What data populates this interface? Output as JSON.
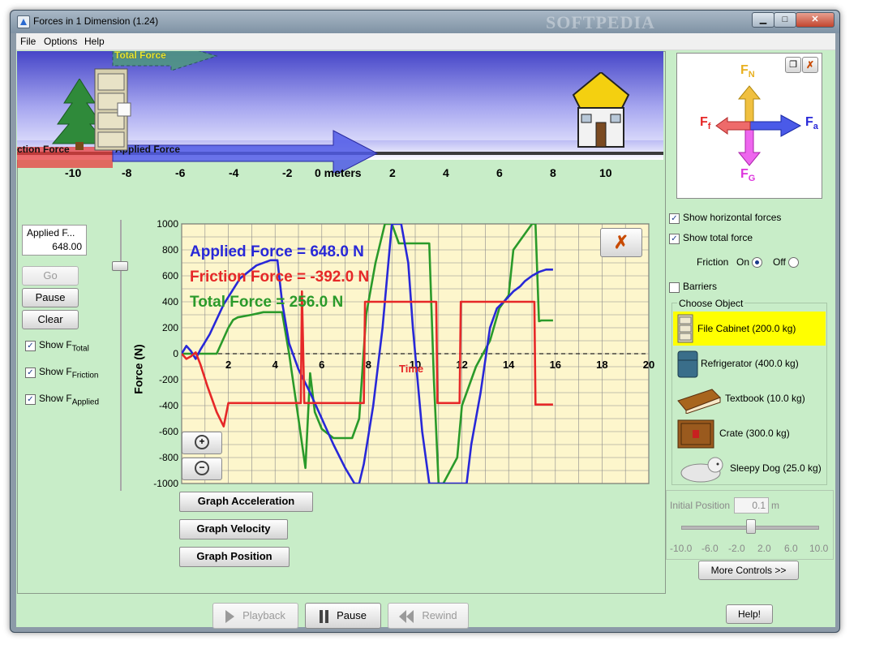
{
  "window": {
    "title": "Forces in 1 Dimension (1.24)",
    "watermark": "SOFTPEDIA",
    "controls": {
      "minimize": "▁",
      "maximize": "□",
      "close": "✕"
    }
  },
  "menu": [
    "File",
    "Options",
    "Help"
  ],
  "scene": {
    "total_force_label": "Total Force",
    "friction_force_label": "ction Force",
    "applied_force_label": "Applied Force",
    "axis_ticks": [
      "-10",
      "-8",
      "-6",
      "-4",
      "-2",
      "0 meters",
      "2",
      "4",
      "6",
      "8",
      "10"
    ]
  },
  "fbd": {
    "fn": "F",
    "fn_sub": "N",
    "ff": "F",
    "ff_sub": "f",
    "fa": "F",
    "fa_sub": "a",
    "fg": "F",
    "fg_sub": "G"
  },
  "left_panel": {
    "applied_field_title": "Applied F...",
    "applied_field_value": "648.00",
    "go": "Go",
    "pause": "Pause",
    "clear": "Clear",
    "show_total": "Show F",
    "show_total_sub": "Total",
    "show_friction": "Show F",
    "show_friction_sub": "Friction",
    "show_applied": "Show F",
    "show_applied_sub": "Applied"
  },
  "graph": {
    "ylabel": "Force (N)",
    "xlabel": "Time",
    "applied_readout": "Applied Force =  648.0 N",
    "friction_readout": "Friction Force =  -392.0 N",
    "total_readout": "Total Force =  256.0 N",
    "close_glyph": "✗",
    "zoom_in": "+",
    "zoom_out": "−"
  },
  "chart_data": {
    "type": "line",
    "xlabel": "Time",
    "ylabel": "Force (N)",
    "xlim": [
      0,
      20
    ],
    "ylim": [
      -1000,
      1000
    ],
    "x_ticks": [
      "2",
      "4",
      "6",
      "8",
      "10",
      "12",
      "14",
      "16",
      "18",
      "20"
    ],
    "y_ticks": [
      "1000",
      "800",
      "600",
      "400",
      "200",
      "0",
      "-200",
      "-400",
      "-600",
      "-800",
      "-1000"
    ],
    "grid": true,
    "series": [
      {
        "name": "Applied Force",
        "color": "#2828d8",
        "x": [
          0,
          0.2,
          0.4,
          0.6,
          0.8,
          1.2,
          1.8,
          2.5,
          3.2,
          3.8,
          4.1,
          4.3,
          4.6,
          5.0,
          5.5,
          6.0,
          6.5,
          7.0,
          7.4,
          7.6,
          7.8,
          8.2,
          8.6,
          9.0,
          9.4,
          9.7,
          9.9,
          10.3,
          10.6,
          10.9,
          11.05,
          11.1,
          12.2,
          12.4,
          12.8,
          13.2,
          13.5,
          13.9,
          14.2,
          14.5,
          14.7,
          15.0,
          15.3,
          15.6,
          15.9
        ],
        "y": [
          0,
          60,
          20,
          -40,
          30,
          150,
          380,
          580,
          680,
          720,
          720,
          400,
          80,
          -120,
          -300,
          -500,
          -700,
          -880,
          -1000,
          -1000,
          -850,
          -400,
          200,
          1000,
          1000,
          700,
          200,
          -600,
          -1000,
          -1000,
          -1000,
          -1000,
          -1000,
          -700,
          -300,
          200,
          350,
          420,
          480,
          520,
          560,
          600,
          630,
          648,
          648
        ]
      },
      {
        "name": "Friction Force",
        "color": "#e62828",
        "x": [
          0,
          0.2,
          0.4,
          0.6,
          0.8,
          1.1,
          1.5,
          1.8,
          2.0,
          2.2,
          5.1,
          5.15,
          5.25,
          7.8,
          7.85,
          10.9,
          10.95,
          11.0,
          11.1,
          11.9,
          11.95,
          15.1,
          15.15,
          15.9
        ],
        "y": [
          0,
          -40,
          -20,
          10,
          -80,
          -250,
          -450,
          -560,
          -380,
          -380,
          -380,
          480,
          -380,
          -380,
          400,
          400,
          -380,
          -380,
          -380,
          -380,
          400,
          400,
          -392,
          -392
        ]
      },
      {
        "name": "Total Force",
        "color": "#2a9a2a",
        "x": [
          0,
          1.0,
          1.5,
          2.0,
          2.2,
          2.4,
          3.0,
          3.5,
          4.3,
          4.6,
          5.0,
          5.3,
          5.5,
          5.7,
          6.0,
          6.5,
          7.3,
          7.6,
          7.9,
          8.3,
          8.7,
          9.0,
          9.3,
          10.6,
          10.8,
          11.0,
          11.2,
          11.8,
          12.0,
          12.6,
          13.2,
          13.6,
          14.0,
          14.2,
          14.6,
          15.0,
          15.15,
          15.3,
          15.4,
          15.9
        ],
        "y": [
          0,
          0,
          0,
          200,
          260,
          280,
          300,
          320,
          320,
          0,
          -500,
          -880,
          -150,
          -450,
          -580,
          -650,
          -650,
          -500,
          300,
          700,
          1000,
          1000,
          850,
          850,
          -200,
          -1000,
          -1000,
          -800,
          -400,
          -100,
          100,
          350,
          450,
          800,
          900,
          1000,
          1000,
          250,
          256,
          256
        ]
      }
    ]
  },
  "graph_buttons": [
    "Graph Acceleration",
    "Graph Velocity",
    "Graph Position"
  ],
  "right_panel": {
    "show_horizontal": "Show horizontal forces",
    "show_total_force": "Show total force",
    "friction_label": "Friction",
    "friction_on": "On",
    "friction_off": "Off",
    "barriers": "Barriers",
    "choose_object": "Choose Object",
    "objects": [
      "File Cabinet (200.0 kg)",
      "Refrigerator (400.0 kg)",
      "Textbook (10.0 kg)",
      "Crate (300.0 kg)",
      "Sleepy Dog (25.0 kg)"
    ],
    "initial_position_label": "Initial Position",
    "initial_position_value": "0.1",
    "initial_position_unit": "m",
    "slider_ticks": [
      "-10.0",
      "-6.0",
      "-2.0",
      "2.0",
      "6.0",
      "10.0"
    ],
    "slider_level": 0.505,
    "more_controls": "More Controls >>",
    "help": "Help!"
  },
  "playback": {
    "playback": "Playback",
    "pause": "Pause",
    "rewind": "Rewind"
  }
}
